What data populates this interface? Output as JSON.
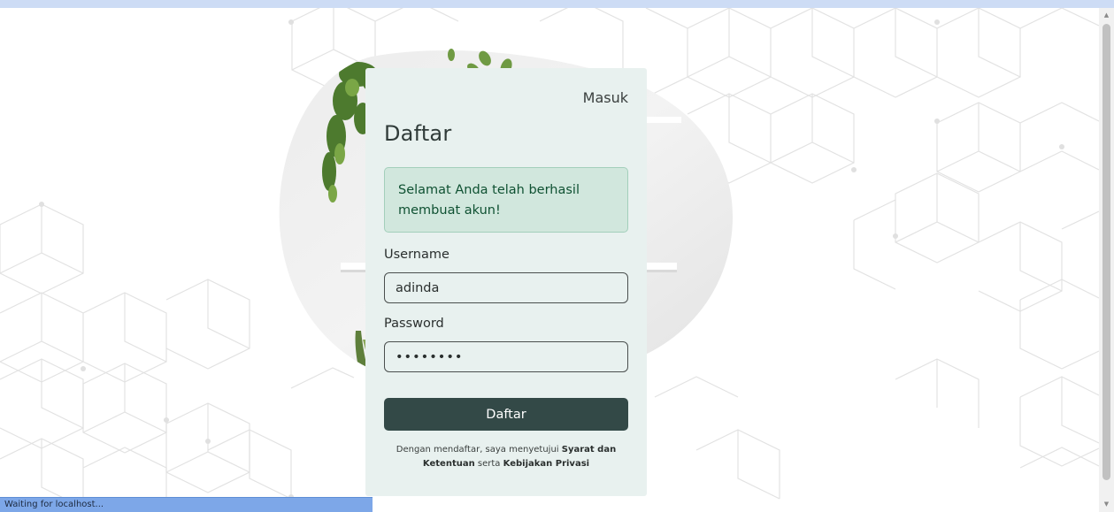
{
  "card": {
    "login_link": "Masuk",
    "title": "Daftar",
    "alert": "Selamat Anda telah berhasil membuat akun!",
    "username_label": "Username",
    "username_value": "adinda",
    "password_label": "Password",
    "password_value": "password",
    "submit_label": "Daftar",
    "terms": {
      "prefix": "Dengan mendaftar, saya menyetujui ",
      "terms_link": "Syarat dan Ketentuan",
      "middle": " serta ",
      "privacy_link": "Kebijakan Privasi"
    }
  },
  "status_bar": {
    "text": "Waiting for localhost..."
  },
  "colors": {
    "card_bg": "#e8f1ef",
    "button_bg": "#334947",
    "alert_bg": "#d1e7dd",
    "alert_text": "#0f5132"
  }
}
